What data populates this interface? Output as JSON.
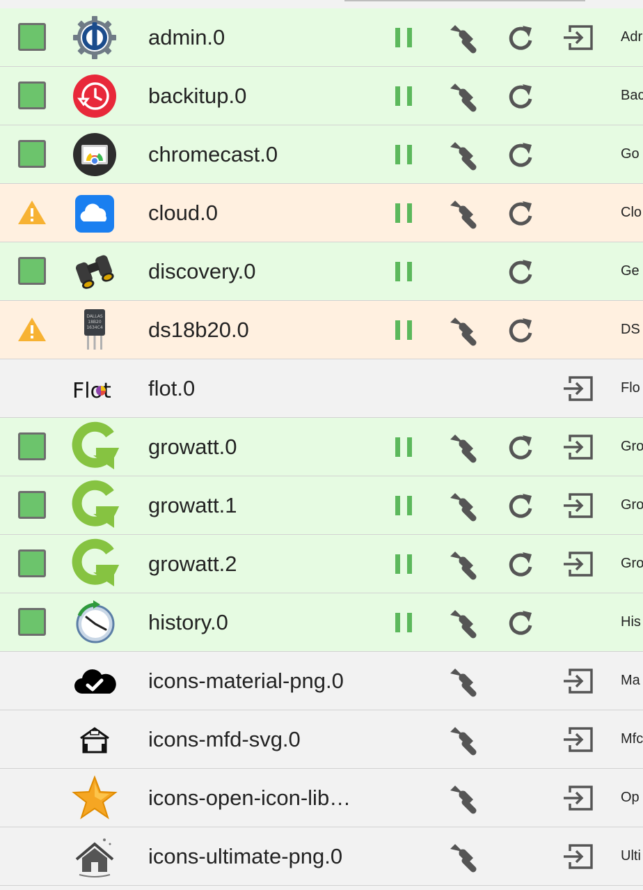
{
  "colors": {
    "running_bg": "#e6fbe2",
    "warning_bg": "#fff0e0",
    "stopped_bg": "#f2f2f2",
    "running_indicator": "#6cc46c",
    "pause_icon": "#5cb85c",
    "warning_icon": "#f7b233",
    "tool_icon": "#555555"
  },
  "adapters": [
    {
      "name": "admin.0",
      "status": "running",
      "logo": "iobroker-admin-logo",
      "desc": "Adr",
      "pause": true,
      "wrench": true,
      "reload": true,
      "enter": true
    },
    {
      "name": "backitup.0",
      "status": "running",
      "logo": "backitup-logo",
      "desc": "Bac",
      "pause": true,
      "wrench": true,
      "reload": true,
      "enter": false
    },
    {
      "name": "chromecast.0",
      "status": "running",
      "logo": "chromecast-logo",
      "desc": "Go",
      "pause": true,
      "wrench": true,
      "reload": true,
      "enter": false
    },
    {
      "name": "cloud.0",
      "status": "warning",
      "logo": "cloud-logo",
      "desc": "Clo",
      "pause": true,
      "wrench": true,
      "reload": true,
      "enter": false
    },
    {
      "name": "discovery.0",
      "status": "running",
      "logo": "binoculars-logo",
      "desc": "Ge",
      "pause": true,
      "wrench": false,
      "reload": true,
      "enter": false
    },
    {
      "name": "ds18b20.0",
      "status": "warning",
      "logo": "sensor-chip-logo",
      "desc": "DS",
      "pause": true,
      "wrench": true,
      "reload": true,
      "enter": false
    },
    {
      "name": "flot.0",
      "status": "none",
      "logo": "flot-logo",
      "logo_text": "Flot",
      "desc": "Flo",
      "pause": false,
      "wrench": false,
      "reload": false,
      "enter": true
    },
    {
      "name": "growatt.0",
      "status": "running",
      "logo": "growatt-logo",
      "desc": "Gro",
      "pause": true,
      "wrench": true,
      "reload": true,
      "enter": true
    },
    {
      "name": "growatt.1",
      "status": "running",
      "logo": "growatt-logo",
      "desc": "Gro",
      "pause": true,
      "wrench": true,
      "reload": true,
      "enter": true
    },
    {
      "name": "growatt.2",
      "status": "running",
      "logo": "growatt-logo",
      "desc": "Gro",
      "pause": true,
      "wrench": true,
      "reload": true,
      "enter": true
    },
    {
      "name": "history.0",
      "status": "running",
      "logo": "history-clock-logo",
      "desc": "His",
      "pause": true,
      "wrench": true,
      "reload": true,
      "enter": false
    },
    {
      "name": "icons-material-png.0",
      "status": "none",
      "logo": "cloud-check-logo",
      "desc": "Ma",
      "pause": false,
      "wrench": true,
      "reload": false,
      "enter": true
    },
    {
      "name": "icons-mfd-svg.0",
      "status": "none",
      "logo": "house-logo",
      "desc": "Mfc",
      "pause": false,
      "wrench": true,
      "reload": false,
      "enter": true
    },
    {
      "name": "icons-open-icon-lib…",
      "status": "none",
      "logo": "star-logo",
      "desc": "Op",
      "pause": false,
      "wrench": true,
      "reload": false,
      "enter": true
    },
    {
      "name": "icons-ultimate-png.0",
      "status": "none",
      "logo": "house-roof-logo",
      "desc": "Ulti",
      "pause": false,
      "wrench": true,
      "reload": false,
      "enter": true
    }
  ]
}
